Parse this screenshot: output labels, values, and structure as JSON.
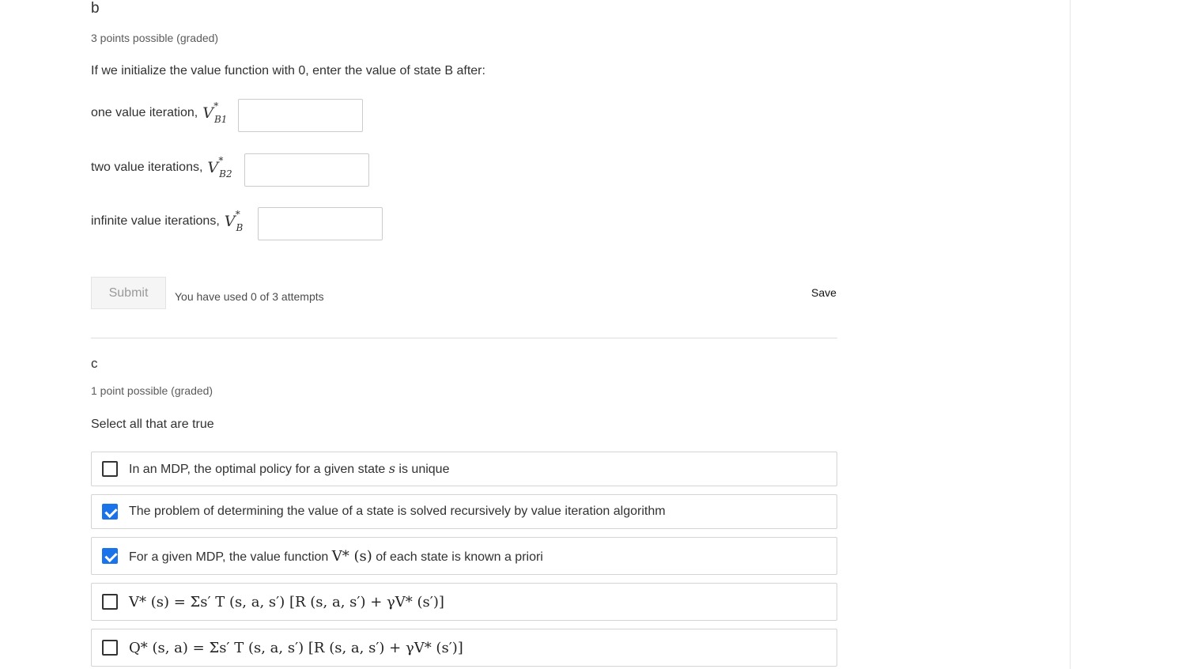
{
  "part_b": {
    "heading": "b",
    "points": "3 points possible (graded)",
    "prompt": "If we initialize the value function with 0, enter the value of state B after:",
    "rows": [
      {
        "label": "one value iteration, ",
        "symbol": "V",
        "superscript": "*",
        "subscript": "B1",
        "value": ""
      },
      {
        "label": "two value iterations, ",
        "symbol": "V",
        "superscript": "*",
        "subscript": "B2",
        "value": ""
      },
      {
        "label": "infinite value iterations, ",
        "symbol": "V",
        "superscript": "*",
        "subscript": "B",
        "value": ""
      }
    ],
    "submit_label": "Submit",
    "attempts_text": "You have used 0 of 3 attempts",
    "save_label": "Save"
  },
  "part_c": {
    "heading": "c",
    "points": "1 point possible (graded)",
    "prompt": "Select all that are true",
    "choices": [
      {
        "text_before": "In an MDP, the optimal policy for a given state ",
        "math": "s",
        "text_after": " is unique",
        "checked": false
      },
      {
        "text_before": "The problem of determining the value of a state is solved recursively by value iteration algorithm",
        "math": "",
        "text_after": "",
        "checked": true
      },
      {
        "text_before": "For a given MDP, the value function ",
        "math": "V* (s)",
        "text_after": " of each state is known a priori",
        "checked": true
      },
      {
        "text_before": "",
        "math": "V* (s) = Σs′ T (s, a, s′) [R (s, a, s′) + γV* (s′)]",
        "text_after": "",
        "checked": false
      },
      {
        "text_before": "",
        "math": "Q* (s, a) = Σs′ T (s, a, s′) [R (s, a, s′) + γV* (s′)]",
        "text_after": "",
        "checked": false
      }
    ]
  },
  "colors": {
    "checkbox_checked": "#1a73e8",
    "text": "#313131",
    "border": "#d4d4d4"
  }
}
